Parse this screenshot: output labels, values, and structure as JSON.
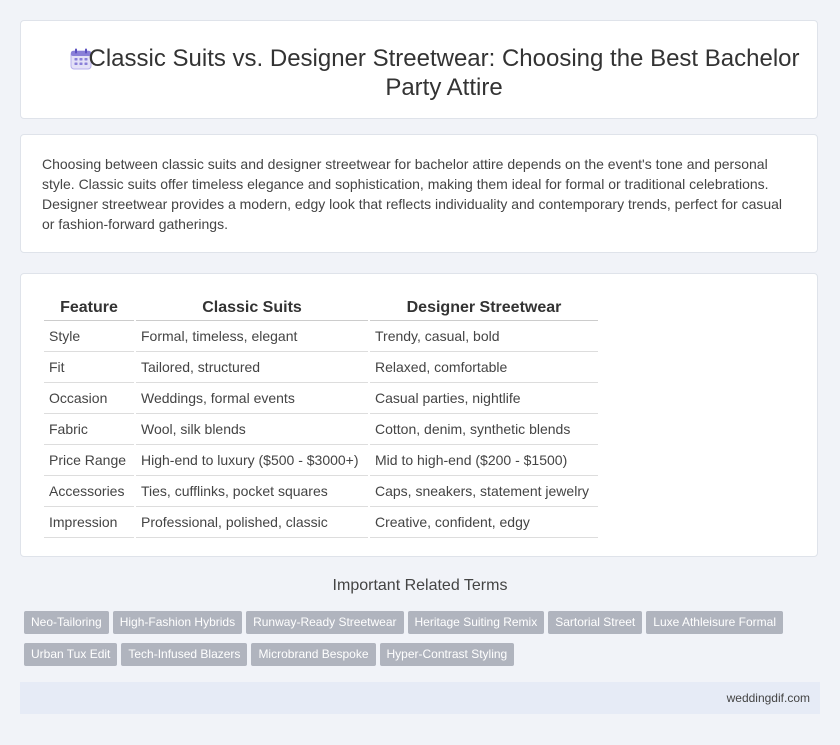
{
  "header": {
    "title": "Classic Suits vs. Designer Streetwear: Choosing the Best Bachelor Party Attire",
    "icon": "calendar-icon"
  },
  "intro": {
    "text": "Choosing between classic suits and designer streetwear for bachelor attire depends on the event's tone and personal style. Classic suits offer timeless elegance and sophistication, making them ideal for formal or traditional celebrations. Designer streetwear provides a modern, edgy look that reflects individuality and contemporary trends, perfect for casual or fashion-forward gatherings."
  },
  "table": {
    "headers": [
      "Feature",
      "Classic Suits",
      "Designer Streetwear"
    ],
    "rows": [
      [
        "Style",
        "Formal, timeless, elegant",
        "Trendy, casual, bold"
      ],
      [
        "Fit",
        "Tailored, structured",
        "Relaxed, comfortable"
      ],
      [
        "Occasion",
        "Weddings, formal events",
        "Casual parties, nightlife"
      ],
      [
        "Fabric",
        "Wool, silk blends",
        "Cotton, denim, synthetic blends"
      ],
      [
        "Price Range",
        "High-end to luxury ($500 - $3000+)",
        "Mid to high-end ($200 - $1500)"
      ],
      [
        "Accessories",
        "Ties, cufflinks, pocket squares",
        "Caps, sneakers, statement jewelry"
      ],
      [
        "Impression",
        "Professional, polished, classic",
        "Creative, confident, edgy"
      ]
    ]
  },
  "related": {
    "title": "Important Related Terms",
    "tags": [
      "Neo-Tailoring",
      "High-Fashion Hybrids",
      "Runway-Ready Streetwear",
      "Heritage Suiting Remix",
      "Sartorial Street",
      "Luxe Athleisure Formal",
      "Urban Tux Edit",
      "Tech-Infused Blazers",
      "Microbrand Bespoke",
      "Hyper-Contrast Styling"
    ]
  },
  "footer": {
    "site": "weddingdif.com"
  },
  "colors": {
    "tag_bg": "#b0b4be",
    "page_bg": "#f1f3f8",
    "footer_bg": "#e6ebf6",
    "icon_accent": "#8a7fd8"
  }
}
